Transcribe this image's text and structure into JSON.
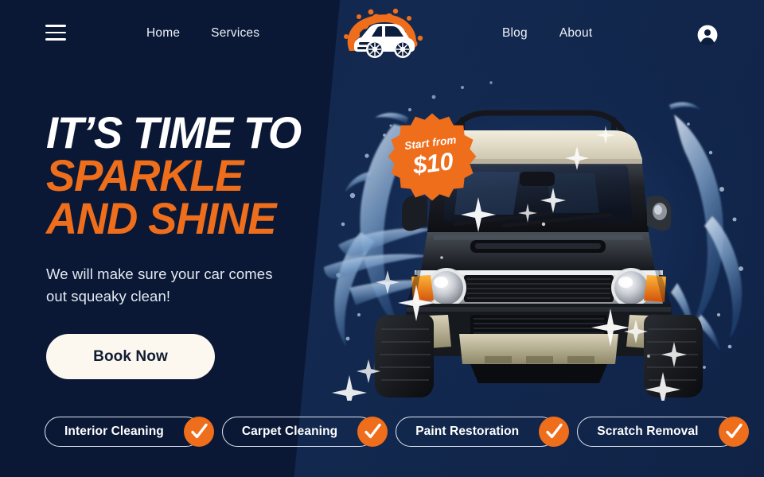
{
  "brand": {
    "logo_icon": "car-with-foam-logo",
    "accent_color": "#ee6e1c",
    "bg_dark": "#0a1836",
    "bg_light": "#13294f",
    "cream": "#fdf8ef"
  },
  "header": {
    "menu_icon": "hamburger-menu-icon",
    "account_icon": "user-account-icon",
    "nav_left": [
      {
        "label": "Home"
      },
      {
        "label": "Services"
      }
    ],
    "nav_right": [
      {
        "label": "Blog"
      },
      {
        "label": "About"
      }
    ]
  },
  "hero": {
    "headline_line1": "IT’S TIME TO",
    "headline_line2": "SPARKLE",
    "headline_line3": "AND SHINE",
    "subcopy": "We will make sure your car comes out squeaky clean!",
    "cta_label": "Book Now",
    "image_alt": "black-suv-with-water-splash"
  },
  "price_badge": {
    "prefix": "Start from",
    "amount": "$10",
    "shape": "starburst-badge"
  },
  "services": [
    {
      "label": "Interior Cleaning",
      "icon": "check-circle-icon"
    },
    {
      "label": "Carpet Cleaning",
      "icon": "check-circle-icon"
    },
    {
      "label": "Paint Restoration",
      "icon": "check-circle-icon"
    },
    {
      "label": "Scratch Removal",
      "icon": "check-circle-icon"
    }
  ]
}
